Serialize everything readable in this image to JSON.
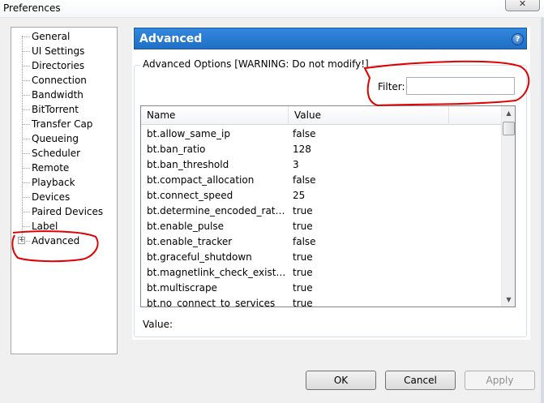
{
  "window": {
    "title": "Preferences",
    "close_symbol": "✕"
  },
  "sidebar": {
    "items": [
      {
        "label": "General"
      },
      {
        "label": "UI Settings"
      },
      {
        "label": "Directories"
      },
      {
        "label": "Connection"
      },
      {
        "label": "Bandwidth"
      },
      {
        "label": "BitTorrent"
      },
      {
        "label": "Transfer Cap"
      },
      {
        "label": "Queueing"
      },
      {
        "label": "Scheduler"
      },
      {
        "label": "Remote"
      },
      {
        "label": "Playback"
      },
      {
        "label": "Devices"
      },
      {
        "label": "Paired Devices"
      },
      {
        "label": "Label"
      },
      {
        "label": "Advanced"
      }
    ],
    "expander_symbol": "+"
  },
  "panel": {
    "title": "Advanced",
    "help_symbol": "?",
    "group_label": "Advanced Options [WARNING: Do not modify!]",
    "filter_label": "Filter:",
    "filter_value": "",
    "columns": {
      "name": "Name",
      "value": "Value"
    },
    "rows": [
      {
        "name": "bt.allow_same_ip",
        "value": "false"
      },
      {
        "name": "bt.ban_ratio",
        "value": "128"
      },
      {
        "name": "bt.ban_threshold",
        "value": "3"
      },
      {
        "name": "bt.compact_allocation",
        "value": "false"
      },
      {
        "name": "bt.connect_speed",
        "value": "25"
      },
      {
        "name": "bt.determine_encoded_rate_fo...",
        "value": "true"
      },
      {
        "name": "bt.enable_pulse",
        "value": "true"
      },
      {
        "name": "bt.enable_tracker",
        "value": "false"
      },
      {
        "name": "bt.graceful_shutdown",
        "value": "true"
      },
      {
        "name": "bt.magnetlink_check_existing_...",
        "value": "true"
      },
      {
        "name": "bt.multiscrape",
        "value": "true"
      },
      {
        "name": "bt.no_connect_to_services",
        "value": "true"
      }
    ],
    "value_label": "Value:"
  },
  "buttons": {
    "ok": "OK",
    "cancel": "Cancel",
    "apply": "Apply"
  },
  "colors": {
    "header_blue": "#2a7bd3",
    "annotation_red": "#e00000"
  }
}
